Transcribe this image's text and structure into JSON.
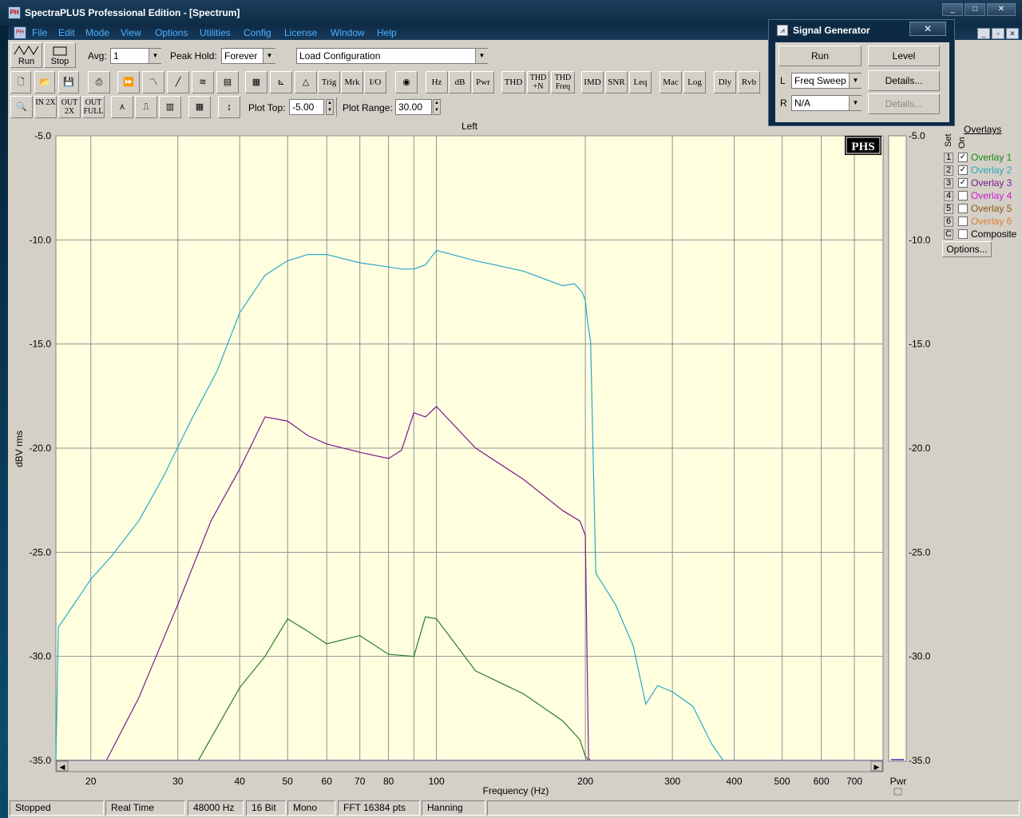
{
  "window": {
    "title": "SpectraPLUS Professional Edition - [Spectrum]",
    "caption_buttons": [
      "_",
      "□",
      "✕"
    ]
  },
  "menu": {
    "items": [
      "File",
      "Edit",
      "Mode",
      "View",
      "Options",
      "Utilities",
      "Config",
      "License",
      "Window",
      "Help"
    ]
  },
  "toolbar": {
    "run_label": "Run",
    "stop_label": "Stop",
    "avg_label": "Avg:",
    "avg_value": "1",
    "peak_hold_label": "Peak Hold:",
    "peak_hold_value": "Forever",
    "load_config_value": "Load Configuration",
    "row2_buttons": [
      "Trig",
      "Mrk",
      "I/O",
      "Hz",
      "dB",
      "Pwr",
      "THD",
      "THD +N",
      "THD Freq",
      "IMD",
      "SNR",
      "Leq",
      "Mac",
      "Log",
      "Dly",
      "Rvb"
    ],
    "row3_buttons": [
      "IN 2X",
      "OUT 2X",
      "OUT FULL"
    ],
    "plot_top_label": "Plot Top:",
    "plot_top_value": "-5.00",
    "plot_range_label": "Plot Range:",
    "plot_range_value": "30.00"
  },
  "signal_generator": {
    "title": "Signal Generator",
    "close_label": "✕",
    "run_label": "Run",
    "level_label": "Level",
    "left_label": "L",
    "left_value": "Freq Sweep",
    "right_label": "R",
    "right_value": "N/A",
    "details_label": "Details...",
    "details_disabled_label": "Details..."
  },
  "plot": {
    "channel_label": "Left",
    "logo": "PHS",
    "pwr_label": "Pwr",
    "y_ticks_right": [
      "-5.0",
      "-10.0",
      "-15.0",
      "-20.0",
      "-25.0",
      "-30.0",
      "-35.0"
    ]
  },
  "overlays": {
    "header": "Overlays",
    "set_label": "Set",
    "on_label": "On",
    "items": [
      {
        "num": "1",
        "label": "Overlay 1",
        "checked": true,
        "color": "#1a8a1a"
      },
      {
        "num": "2",
        "label": "Overlay 2",
        "checked": true,
        "color": "#2aa8b0"
      },
      {
        "num": "3",
        "label": "Overlay 3",
        "checked": true,
        "color": "#7a1a8a"
      },
      {
        "num": "4",
        "label": "Overlay 4",
        "checked": false,
        "color": "#d020d0"
      },
      {
        "num": "5",
        "label": "Overlay 5",
        "checked": false,
        "color": "#8a5a10"
      },
      {
        "num": "6",
        "label": "Overlay 6",
        "checked": false,
        "color": "#e08030"
      },
      {
        "num": "C",
        "label": "Composite",
        "checked": false,
        "color": "#000000"
      }
    ],
    "options_label": "Options..."
  },
  "status": {
    "items": [
      "Stopped",
      "Real Time",
      "48000 Hz",
      "16 Bit",
      "Mono",
      "FFT 16384 pts",
      "Hanning"
    ]
  },
  "chart_data": {
    "type": "line",
    "title": "Left",
    "xlabel": "Frequency (Hz)",
    "ylabel": "dBV rms",
    "x_scale": "log",
    "xlim": [
      17,
      800
    ],
    "ylim": [
      -35,
      -5
    ],
    "x_ticks": [
      20,
      30,
      40,
      50,
      60,
      70,
      80,
      100,
      200,
      300,
      400,
      500,
      600,
      700
    ],
    "y_ticks": [
      -5,
      -10,
      -15,
      -20,
      -25,
      -30,
      -35
    ],
    "grid": true,
    "series": [
      {
        "color": "#2aa8c8",
        "x": [
          17,
          17.2,
          20,
          22,
          25,
          28,
          32,
          36,
          40,
          45,
          50,
          55,
          60,
          70,
          80,
          85,
          90,
          95,
          100,
          120,
          150,
          180,
          190,
          197,
          200,
          202,
          205,
          210,
          230,
          250,
          265,
          280,
          300,
          330,
          360,
          380
        ],
        "y": [
          -35,
          -28.6,
          -26.3,
          -25.2,
          -23.5,
          -21.4,
          -18.6,
          -16.3,
          -13.5,
          -11.7,
          -11.0,
          -10.7,
          -10.7,
          -11.1,
          -11.3,
          -11.4,
          -11.4,
          -11.2,
          -10.5,
          -11.0,
          -11.5,
          -12.2,
          -12.1,
          -12.5,
          -12.9,
          -13.9,
          -14.9,
          -26.0,
          -27.5,
          -29.5,
          -32.3,
          -31.4,
          -31.7,
          -32.4,
          -34.2,
          -35
        ]
      },
      {
        "color": "#7a1a8a",
        "x": [
          21.5,
          25,
          30,
          35,
          40,
          45,
          50,
          55,
          60,
          70,
          80,
          85,
          90,
          95,
          100,
          120,
          150,
          180,
          195,
          200,
          203,
          205
        ],
        "y": [
          -35,
          -32,
          -27.5,
          -23.5,
          -21.0,
          -18.5,
          -18.7,
          -19.4,
          -19.8,
          -20.2,
          -20.5,
          -20.1,
          -18.3,
          -18.5,
          -18.0,
          -20.0,
          -21.5,
          -23.0,
          -23.5,
          -24.2,
          -34.9,
          -35
        ]
      },
      {
        "color": "#2a7a2a",
        "x": [
          17,
          33,
          40,
          45,
          50,
          55,
          60,
          70,
          80,
          90,
          95,
          100,
          120,
          150,
          180,
          195,
          200,
          203
        ],
        "y": [
          -35,
          -35,
          -31.5,
          -30.0,
          -28.2,
          -28.8,
          -29.4,
          -29.0,
          -29.9,
          -30.0,
          -28.1,
          -28.2,
          -30.7,
          -31.8,
          -33.1,
          -34.0,
          -34.8,
          -35
        ]
      }
    ]
  }
}
